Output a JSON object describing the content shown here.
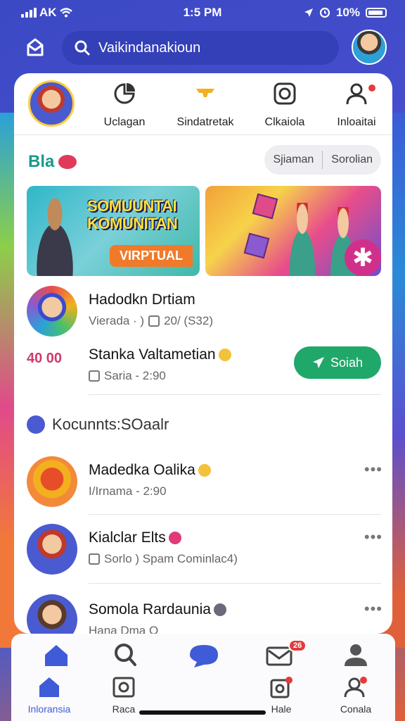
{
  "status": {
    "carrier": "AK",
    "time": "1:5 PM",
    "battery": "10%"
  },
  "search": {
    "query": "Vaikindanakioun"
  },
  "tabs": [
    {
      "label": "Uclagan",
      "icon": "chart-pie-icon"
    },
    {
      "label": "Sindatretak",
      "icon": "bowl-icon"
    },
    {
      "label": "Clkaiola",
      "icon": "camera-icon"
    },
    {
      "label": "Inloaitai",
      "icon": "person-icon"
    }
  ],
  "brand": {
    "text": "Bla"
  },
  "segment": {
    "left": "Sjiaman",
    "right": "Sorolian"
  },
  "banners": {
    "first": {
      "line1": "SOMUUNTAI",
      "line2": "KOMUNITAN",
      "pill": "VIRPTUAL"
    },
    "second": {
      "badge": "✱"
    }
  },
  "featured": [
    {
      "title": "Hadodkn Drtiam",
      "meta1": "Vierada · )",
      "meta2": "20/ (S32)"
    },
    {
      "title": "Stanka Valtametian",
      "meta": "Saria - 2:90",
      "numbers": "40 00",
      "action": "Soiah"
    }
  ],
  "section": {
    "title": "Kocunnts:SOaalr"
  },
  "list": [
    {
      "title": "Madedka Oalika",
      "meta": "I/Irnama - 2:90"
    },
    {
      "title": "Kialclar Elts",
      "meta": "Sorlo ) Spam Cominlac4)"
    },
    {
      "title": "Somola Rardaunia",
      "meta": "Hana Dma O"
    }
  ],
  "bottom_nav": {
    "top_badge": "26",
    "items": [
      {
        "label": "Inloransia",
        "icon": "home-icon"
      },
      {
        "label": "Raca",
        "icon": "photo-icon"
      },
      {
        "label": "",
        "icon": "chat-bubble-icon"
      },
      {
        "label": "Hale",
        "icon": "mail-icon"
      },
      {
        "label": "Conala",
        "icon": "person-icon"
      }
    ]
  },
  "colors": {
    "primary": "#3b49c4",
    "accent_green": "#1fa86a",
    "badge_red": "#e43b3b",
    "icon_blue": "#3f5bd8"
  }
}
